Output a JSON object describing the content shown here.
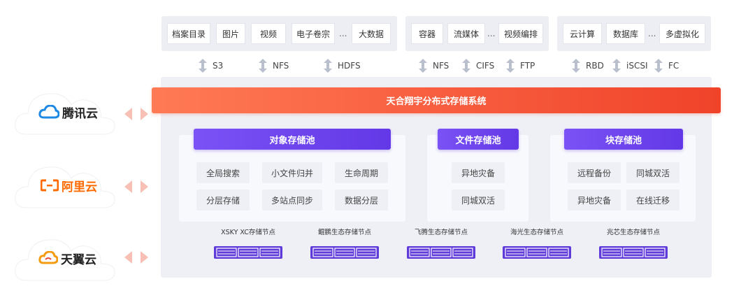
{
  "apps": {
    "group1": [
      "档案目录",
      "图片",
      "视频",
      "电子卷宗",
      "...",
      "大数据"
    ],
    "group2": [
      "容器",
      "流媒体",
      "...",
      "视频编排"
    ],
    "group3": [
      "云计算",
      "数据库",
      "...",
      "多虚拟化"
    ]
  },
  "protocols": [
    "S3",
    "NFS",
    "HDFS",
    "NFS",
    "CIFS",
    "FTP",
    "RBD",
    "iSCSI",
    "FC"
  ],
  "system_title": "天合翔宇分布式存储系统",
  "pools": [
    {
      "title": "对象存储池",
      "features": [
        "全局搜索",
        "小文件归并",
        "生命周期",
        "分层存储",
        "多站点同步",
        "数据分层"
      ]
    },
    {
      "title": "文件存储池",
      "features": [
        "异地灾备",
        "同城双活"
      ]
    },
    {
      "title": "块存储池",
      "features": [
        "远程备份",
        "同城双活",
        "异地灾备",
        "在线迁移"
      ]
    }
  ],
  "nodes": [
    "XSKY XC存储节点",
    "鲲鹏生态存储节点",
    "飞腾生态存储节点",
    "海光生态存储节点",
    "兆芯生态存储节点"
  ],
  "clouds": [
    {
      "name": "腾讯云",
      "icon": "tencent-cloud-logo-icon",
      "color": "#1e88e5"
    },
    {
      "name": "阿里云",
      "icon": "aliyun-logo-icon",
      "color": "#ff6a00"
    },
    {
      "name": "天翼云",
      "icon": "tianyi-cloud-logo-icon",
      "color": "#f39c12"
    }
  ],
  "colors": {
    "banner": "#f0432a",
    "pool_header": "#6338e6",
    "arrow": "#b9bfcc",
    "double_arrow": "#f8c0b4"
  }
}
